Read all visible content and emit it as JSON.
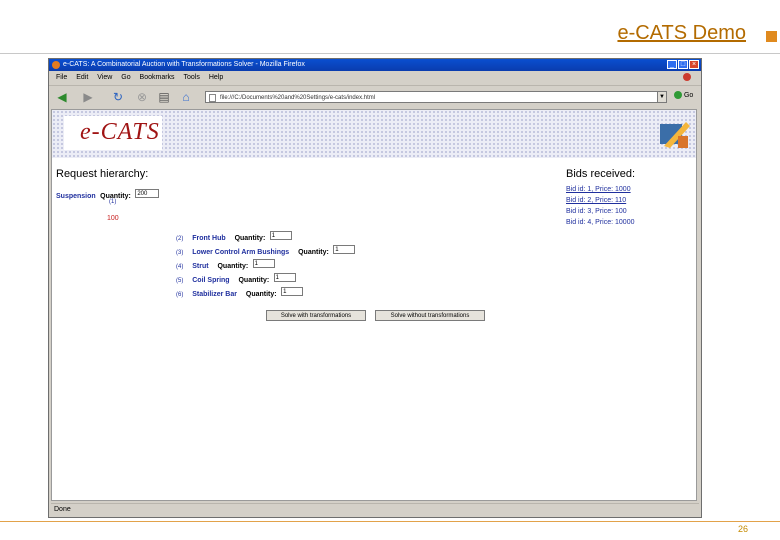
{
  "slide": {
    "title": "e-CATS Demo",
    "page_number": "26",
    "accent_color": "#e08a1e"
  },
  "browser": {
    "window_title": "e-CATS: A Combinatorial Auction with Transformations Solver - Mozilla Firefox",
    "menu": [
      "File",
      "Edit",
      "View",
      "Go",
      "Bookmarks",
      "Tools",
      "Help"
    ],
    "url": "file:///C:/Documents%20and%20Settings/e-cats/index.html",
    "go_label": "Go",
    "status_text": "Done",
    "nav_icons": [
      "back-icon",
      "forward-icon",
      "reload-icon",
      "stop-icon",
      "print-icon",
      "home-icon"
    ]
  },
  "banner": {
    "logo": "e-CATS"
  },
  "request": {
    "title": "Request hierarchy:",
    "root": {
      "label": "Suspension",
      "quantity_label": "Quantity:",
      "quantity_value": "200"
    },
    "root_index": "(1)",
    "root_number": "100",
    "children": [
      {
        "index": "(2)",
        "label": "Front Hub",
        "quantity_label": "Quantity:",
        "quantity_value": "1"
      },
      {
        "index": "(3)",
        "label": "Lower Control Arm Bushings",
        "quantity_label": "Quantity:",
        "quantity_value": "1"
      },
      {
        "index": "(4)",
        "label": "Strut",
        "quantity_label": "Quantity:",
        "quantity_value": "1"
      },
      {
        "index": "(5)",
        "label": "Coil Spring",
        "quantity_label": "Quantity:",
        "quantity_value": "1"
      },
      {
        "index": "(6)",
        "label": "Stabilizer Bar",
        "quantity_label": "Quantity:",
        "quantity_value": "1"
      }
    ],
    "buttons": [
      "Solve with transformations",
      "Solve without transformations"
    ]
  },
  "bids": {
    "title": "Bids received:",
    "items": [
      "Bid id: 1, Price: 1000",
      "Bid id: 2, Price: 110",
      "Bid id: 3, Price: 100",
      "Bid id: 4, Price: 10000"
    ]
  }
}
